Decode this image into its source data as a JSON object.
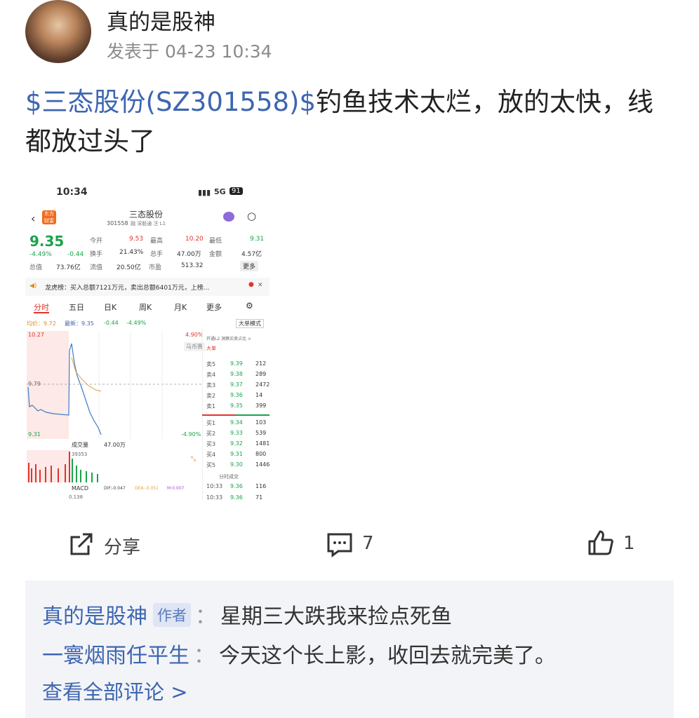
{
  "post": {
    "author": "真的是股神",
    "time": "发表于 04-23 10:34",
    "stock_tag": "$三态股份(SZ301558)$",
    "text_line1": "钓鱼技术太烂，放的太快，线",
    "text_line2": "都放过头了"
  },
  "shot": {
    "status_time": "10:34",
    "network": "5G",
    "battery": "91",
    "stock_name": "三态股份",
    "stock_code": "301558",
    "code_tags": "融 深股通 注 L1",
    "price": "9.35",
    "change_pct": "-4.49%",
    "change_abs": "-0.44",
    "stats": [
      {
        "label": "今开",
        "value": "9.53"
      },
      {
        "label": "最高",
        "value": "10.20"
      },
      {
        "label": "最低",
        "value": "9.31"
      },
      {
        "label": "换手",
        "value": "21.43%"
      },
      {
        "label": "总手",
        "value": "47.00万"
      },
      {
        "label": "金额",
        "value": "4.57亿"
      },
      {
        "label": "总值",
        "value": "73.76亿"
      },
      {
        "label": "流值",
        "value": "20.50亿"
      },
      {
        "label": "市盈",
        "value": "513.32"
      }
    ],
    "more_btn": "更多",
    "notice": "龙虎榜：买入总额7121万元，卖出总额6401万元，上榜...",
    "tabs": [
      "分时",
      "五日",
      "日K",
      "周K",
      "月K",
      "更多"
    ],
    "avg_label": "均价：9.72",
    "latest_label": "最新：9.35",
    "latest_chg": "-0.44",
    "latest_pct": "-4.49%",
    "big_mode": "大单模式",
    "y_top": "10.27",
    "y_mid": "9.79",
    "y_bot": "9.31",
    "pct_top": "4.90%",
    "pct_bot": "-4.90%",
    "overlay_chip": "马币赛",
    "l2_hint": "开通L2 洞察买卖占比 >",
    "big_label": "大单",
    "vol_label": "成交量",
    "vol_value": "47.00万",
    "vol_peak": "39353",
    "macd_label": "MACD",
    "dif": "DIF:-0.047",
    "dea": "DEA:-0.051",
    "m_val": "M:0.007",
    "macd_num": "0.138",
    "order_book": {
      "asks": [
        {
          "label": "卖5",
          "price": "9.39",
          "vol": "212"
        },
        {
          "label": "卖4",
          "price": "9.38",
          "vol": "289"
        },
        {
          "label": "卖3",
          "price": "9.37",
          "vol": "2472"
        },
        {
          "label": "卖2",
          "price": "9.36",
          "vol": "14"
        },
        {
          "label": "卖1",
          "price": "9.35",
          "vol": "399"
        }
      ],
      "bids": [
        {
          "label": "买1",
          "price": "9.34",
          "vol": "103"
        },
        {
          "label": "买2",
          "price": "9.33",
          "vol": "539"
        },
        {
          "label": "买3",
          "price": "9.32",
          "vol": "1481"
        },
        {
          "label": "买4",
          "price": "9.31",
          "vol": "800"
        },
        {
          "label": "买5",
          "price": "9.30",
          "vol": "1446"
        }
      ]
    },
    "trades_title": "分时成交",
    "trades": [
      {
        "time": "10:33",
        "price": "9.36",
        "vol": "116"
      },
      {
        "time": "10:33",
        "price": "9.36",
        "vol": "71"
      }
    ]
  },
  "actions": {
    "share": "分享",
    "comments": "7",
    "likes": "1"
  },
  "comments": [
    {
      "name": "真的是股神",
      "badge": "作者",
      "text": "星期三大跌我来捡点死鱼"
    },
    {
      "name": "一寰烟雨任平生",
      "badge": "",
      "text": "今天这个长上影，收回去就完美了。"
    }
  ],
  "view_all": "查看全部评论 >",
  "colors": {
    "link": "#3d66b0",
    "up": "#e0342b",
    "down": "#1aa34a"
  }
}
